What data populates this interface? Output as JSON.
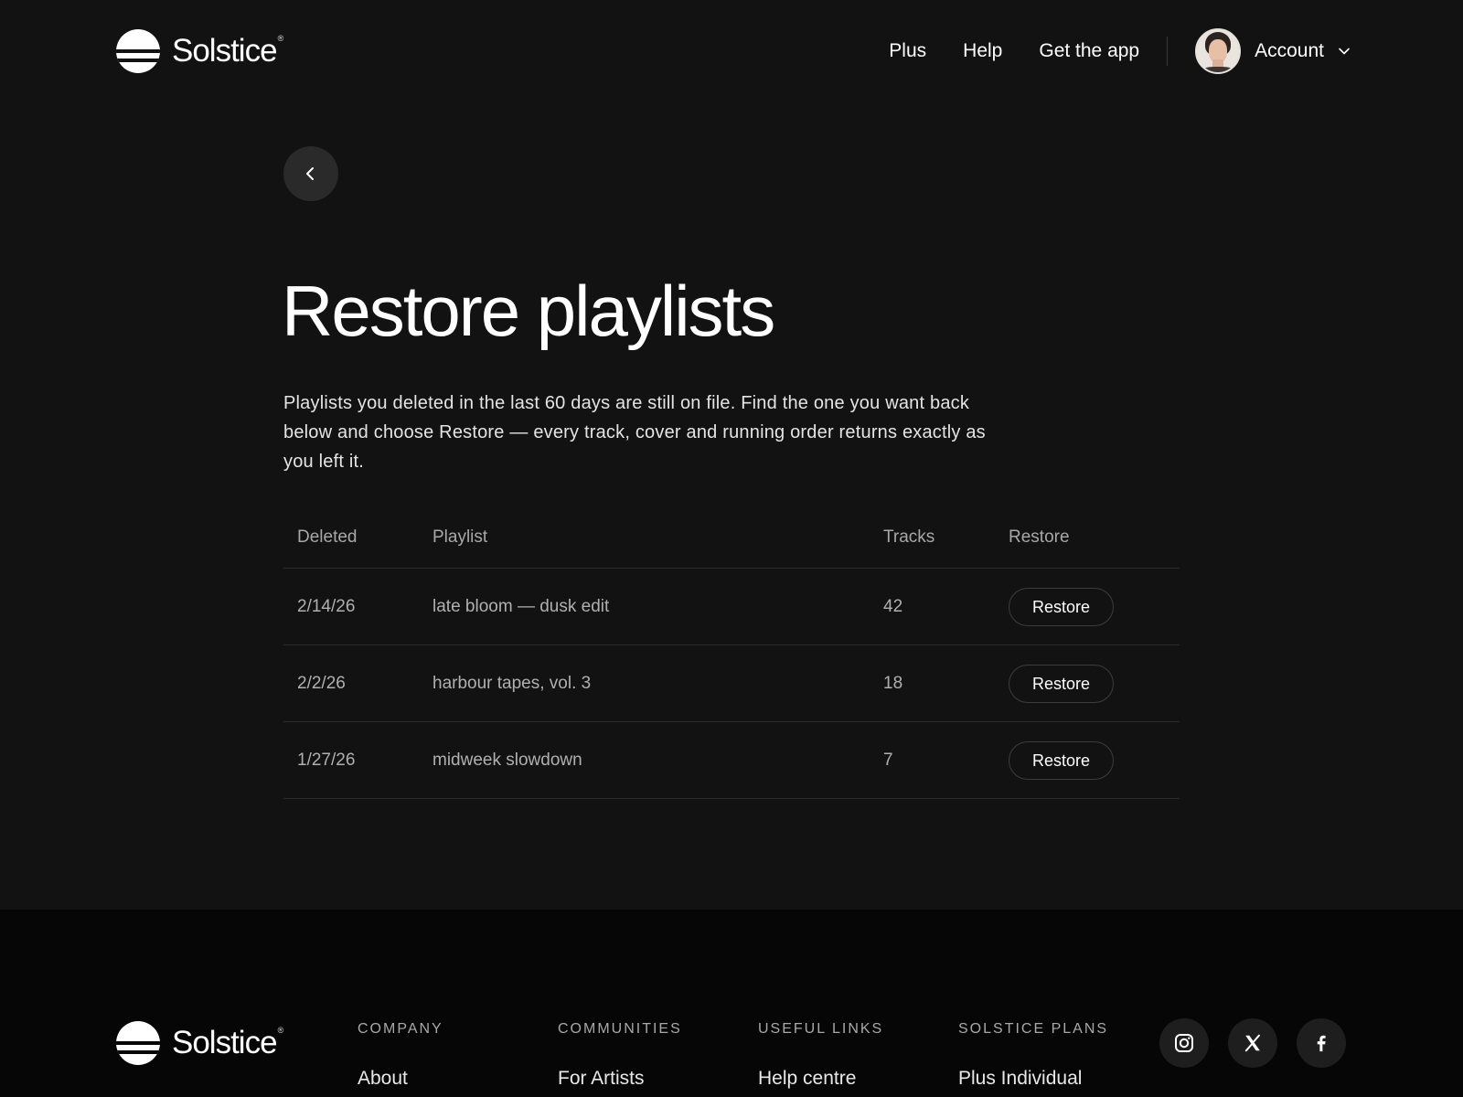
{
  "brand": {
    "name": "Solstice",
    "mark": "®"
  },
  "nav": {
    "links": [
      "Plus",
      "Help",
      "Get the app"
    ],
    "account_label": "Account"
  },
  "main": {
    "title": "Restore playlists",
    "intro": "Playlists you deleted in the last 60 days are still on file. Find the one you want back below and choose Restore — every track, cover and running order returns exactly as you left it.",
    "table": {
      "headers": [
        "Deleted",
        "Playlist",
        "Tracks",
        "Restore"
      ],
      "rows": [
        {
          "deleted": "2/14/26",
          "playlist": "late bloom — dusk edit",
          "tracks": "42",
          "action": "Restore"
        },
        {
          "deleted": "2/2/26",
          "playlist": "harbour tapes, vol. 3",
          "tracks": "18",
          "action": "Restore"
        },
        {
          "deleted": "1/27/26",
          "playlist": "midweek slowdown",
          "tracks": "7",
          "action": "Restore"
        }
      ]
    }
  },
  "footer": {
    "columns": [
      {
        "heading": "COMPANY",
        "first_link": "About"
      },
      {
        "heading": "COMMUNITIES",
        "first_link": "For Artists"
      },
      {
        "heading": "USEFUL LINKS",
        "first_link": "Help centre"
      },
      {
        "heading": "SOLSTICE PLANS",
        "first_link": "Plus Individual"
      }
    ],
    "social": [
      "instagram-icon",
      "x-icon",
      "facebook-icon"
    ]
  },
  "colors": {
    "background": "#121212",
    "footer_background": "#060606",
    "text": "#ffffff",
    "muted": "#a8a8a8"
  }
}
